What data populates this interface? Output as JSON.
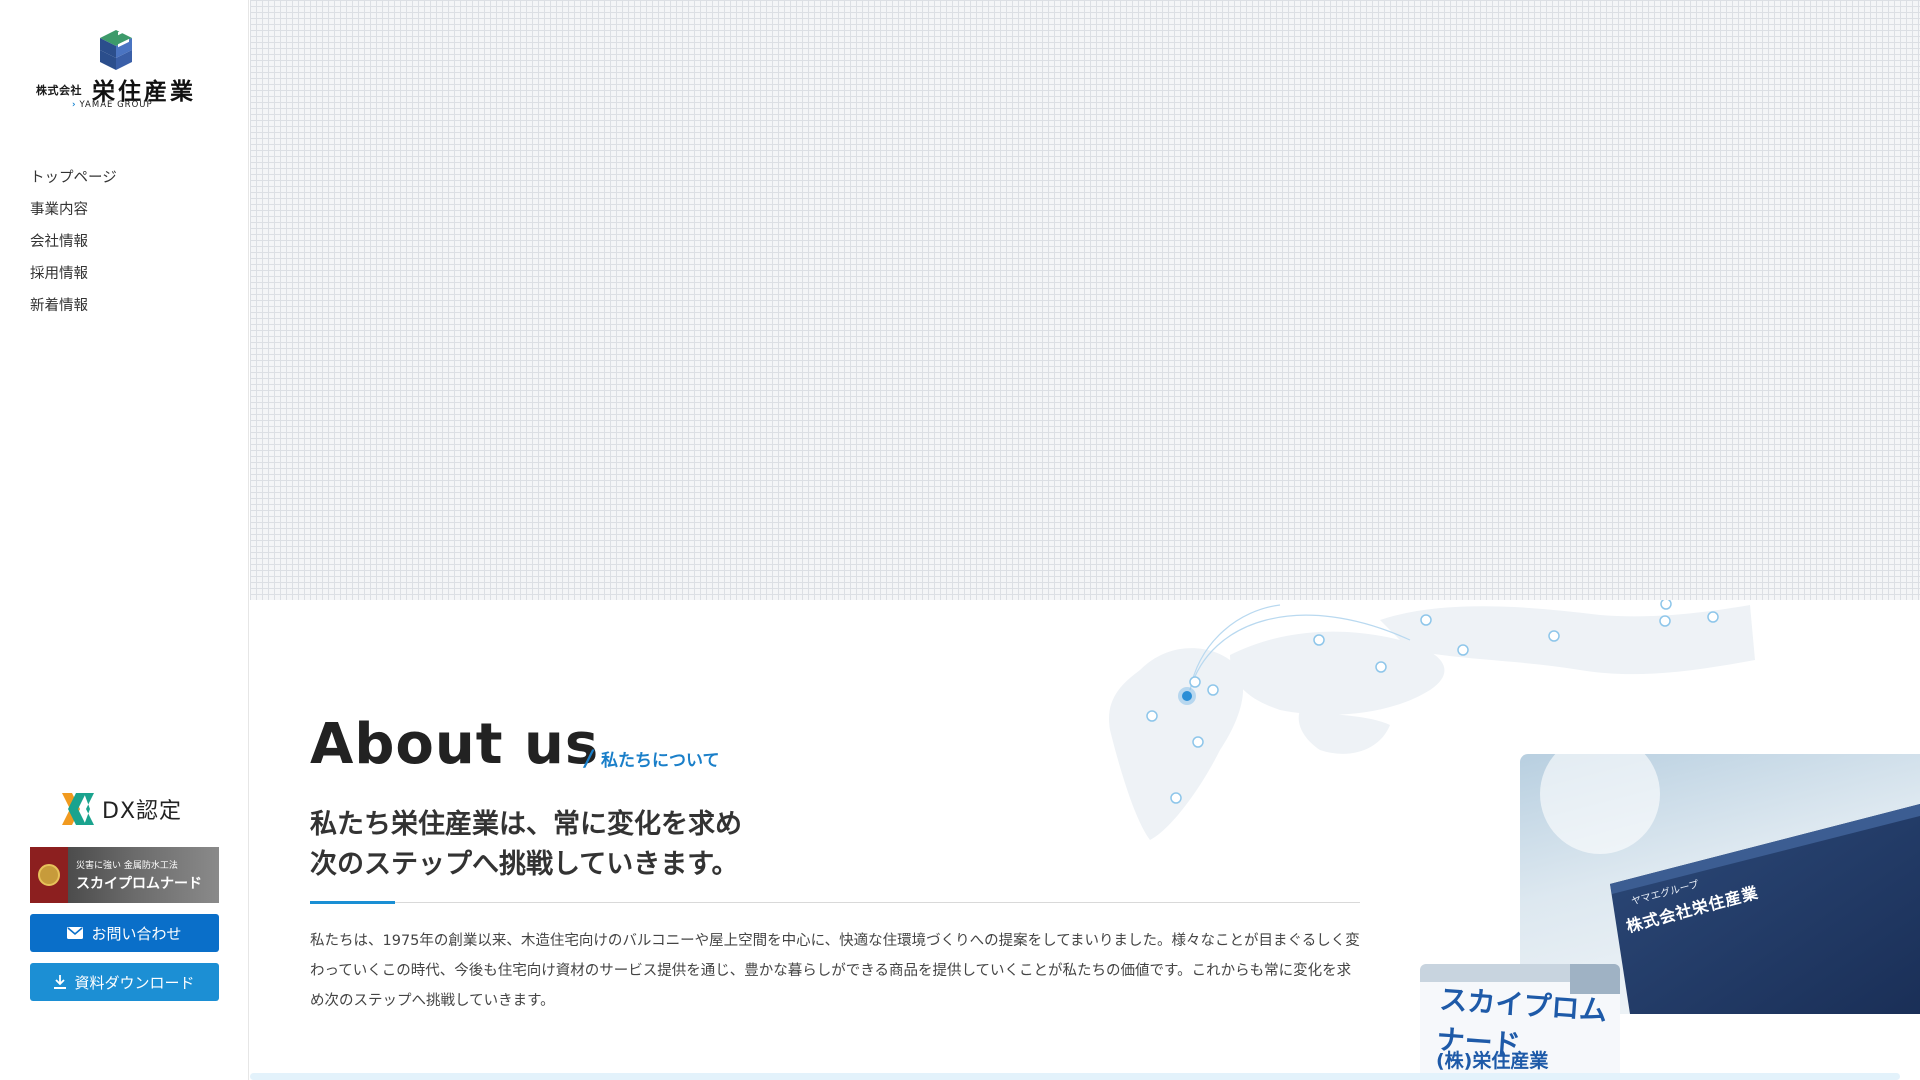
{
  "logo": {
    "prefix": "株式会社",
    "name": "栄住産業",
    "group": "YAMAE GROUP"
  },
  "nav": {
    "items": [
      {
        "label": "トップページ"
      },
      {
        "label": "事業内容"
      },
      {
        "label": "会社情報"
      },
      {
        "label": "採用情報"
      },
      {
        "label": "新着情報"
      }
    ]
  },
  "dx": {
    "label": "DX認定"
  },
  "banner": {
    "sub": "災害に強い 金属防水工法",
    "main": "スカイプロムナード"
  },
  "buttons": {
    "contact": "お問い合わせ",
    "download": "資料ダウンロード"
  },
  "about": {
    "title": "About us",
    "subtitle": "私たちについて",
    "lead_line1": "私たち栄住産業は、常に変化を求め",
    "lead_line2": "次のステップへ挑戦していきます。",
    "body": "私たちは、1975年の創業以来、木造住宅向けのバルコニーや屋上空間を中心に、快適な住環境づくりへの提案をしてまいりました。様々なことが目まぐるしく変わっていくこの時代、今後も住宅向け資材のサービス提供を通じ、豊かな暮らしができる商品を提供していくことが私たちの価値です。これからも常に変化を求め次のステップへ挑戦していきます。"
  },
  "photos": {
    "building_sign_small": "ヤマエグループ",
    "building_sign": "株式会社栄住産業",
    "sign_title": "スカイプロムナード",
    "sign_company": "(株)栄住産業"
  },
  "colors": {
    "accent": "#1a8fd4",
    "button_contact": "#0a6fc9",
    "button_download": "#1c8fd4"
  }
}
